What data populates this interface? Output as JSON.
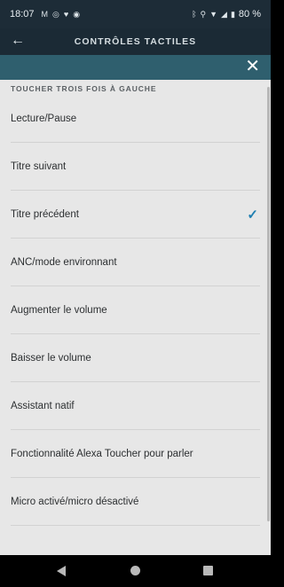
{
  "status_bar": {
    "time": "18:07",
    "left_icons": [
      "gmail-icon",
      "instagram-icon",
      "heart-icon",
      "app-icon"
    ],
    "right_icons": [
      "bluetooth-icon",
      "location-icon",
      "wifi-icon",
      "signal-icon",
      "battery-icon"
    ],
    "battery": "80 %"
  },
  "header": {
    "title": "CONTRÔLES TACTILES"
  },
  "sheet": {
    "section_title": "TOUCHER TROIS FOIS À GAUCHE",
    "options": [
      {
        "label": "Lecture/Pause",
        "selected": false
      },
      {
        "label": "Titre suivant",
        "selected": false
      },
      {
        "label": "Titre précédent",
        "selected": true
      },
      {
        "label": "ANC/mode environnant",
        "selected": false
      },
      {
        "label": "Augmenter le volume",
        "selected": false
      },
      {
        "label": "Baisser le volume",
        "selected": false
      },
      {
        "label": "Assistant natif",
        "selected": false
      },
      {
        "label": "Fonctionnalité Alexa Toucher pour parler",
        "selected": false
      },
      {
        "label": "Micro activé/micro désactivé",
        "selected": false
      }
    ],
    "check_symbol": "✓"
  },
  "colors": {
    "header_bg": "#1b2a35",
    "sheet_top_bg": "#2f5f6e",
    "sheet_bg": "#e7e7e7",
    "check": "#1f7fb1"
  }
}
